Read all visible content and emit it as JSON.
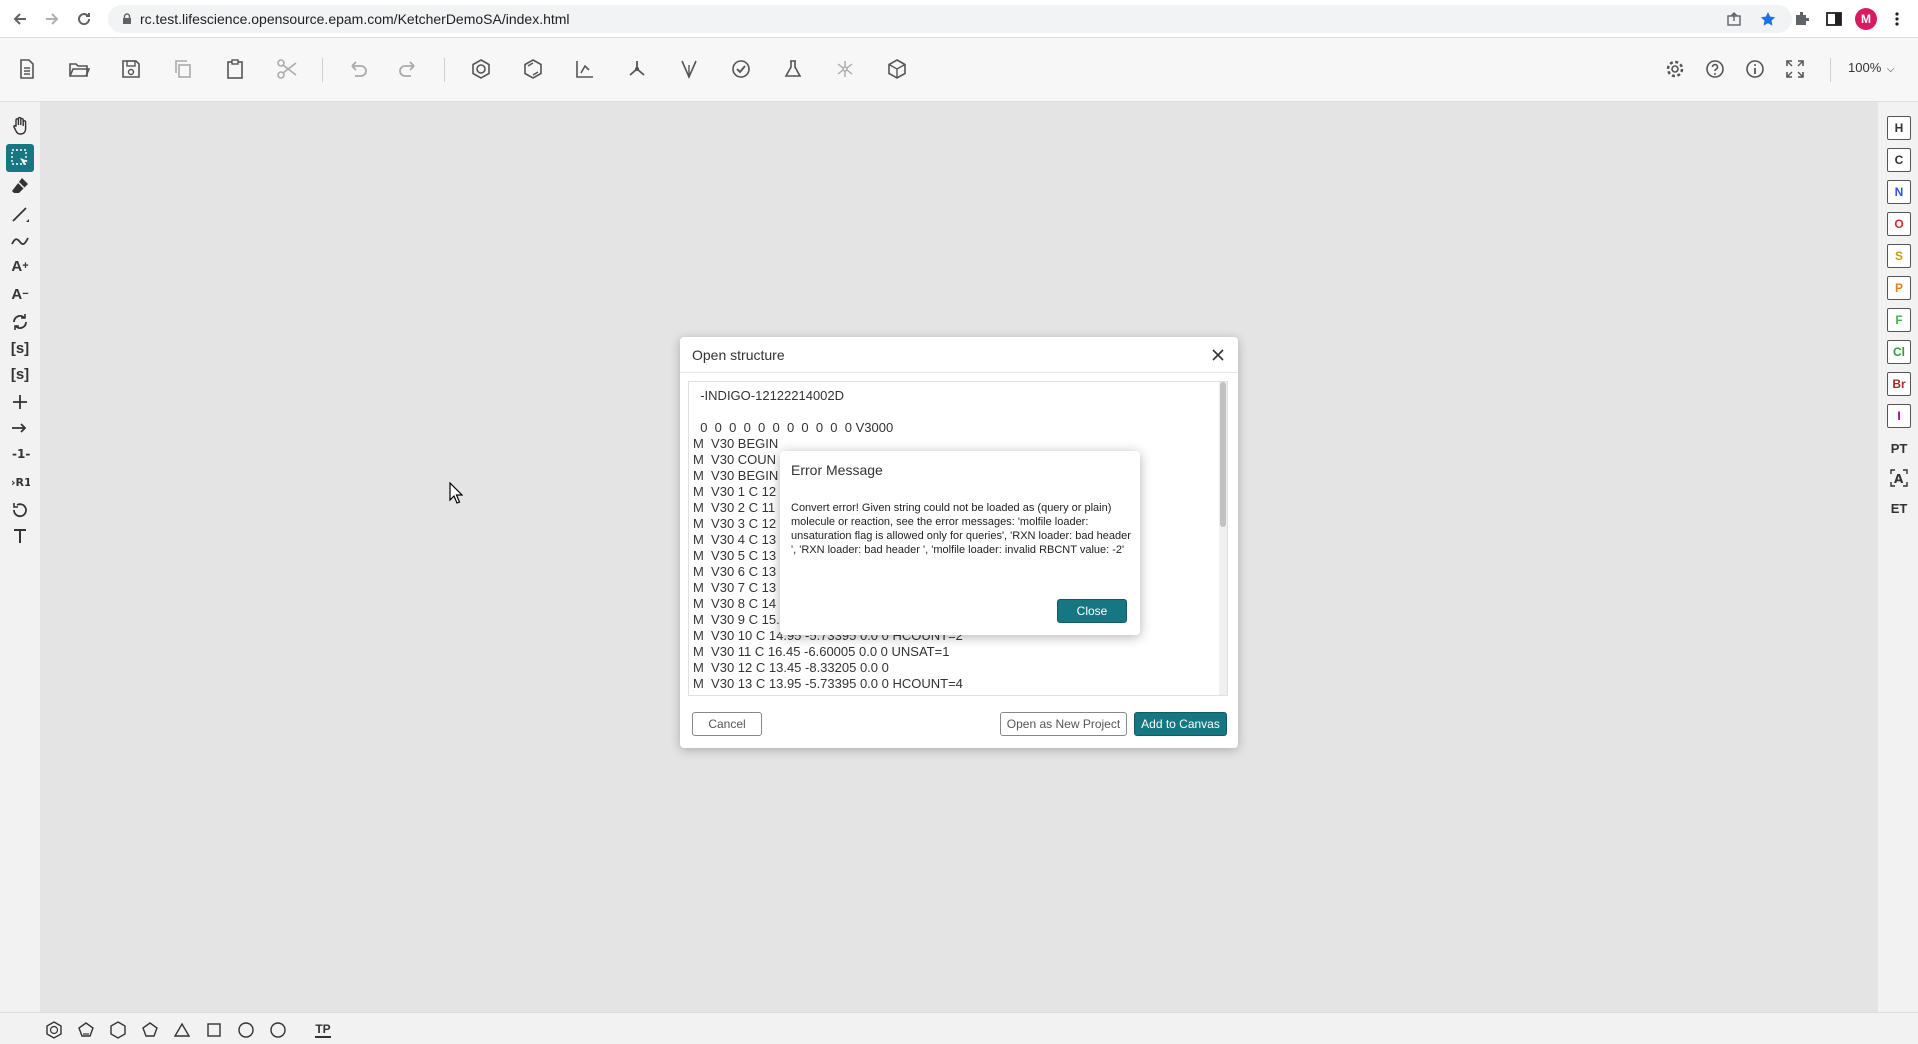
{
  "browser": {
    "url": "rc.test.lifescience.opensource.epam.com/KetcherDemoSA/index.html",
    "avatar_letter": "M"
  },
  "toolbar": {
    "zoom": "100%"
  },
  "elements": [
    "H",
    "C",
    "N",
    "O",
    "S",
    "P",
    "F",
    "Cl",
    "Br",
    "I"
  ],
  "element_colors": [
    "#333333",
    "#333333",
    "#3050f8",
    "#d32f2f",
    "#c8a000",
    "#e67e22",
    "#4caf50",
    "#2e9d2e",
    "#a52a2a",
    "#940094"
  ],
  "right_extra": [
    "PT",
    "ET"
  ],
  "open_dialog": {
    "title": "Open structure",
    "molfile": [
      "  -INDIGO-12122214002D",
      "",
      "  0  0  0  0  0  0  0  0  0  0  0 V3000",
      "M  V30 BEGIN",
      "M  V30 COUN",
      "M  V30 BEGIN",
      "M  V30 1 C 12",
      "M  V30 2 C 11",
      "M  V30 3 C 12",
      "M  V30 4 C 13",
      "M  V30 5 C 13",
      "M  V30 6 C 13",
      "M  V30 7 C 13",
      "M  V30 8 C 14",
      "M  V30 9 C 15.45 -6.60005 0.0 0",
      "M  V30 10 C 14.95 -5.73395 0.0 0 HCOUNT=2",
      "M  V30 11 C 16.45 -6.60005 0.0 0 UNSAT=1",
      "M  V30 12 C 13.45 -8.33205 0.0 0",
      "M  V30 13 C 13.95 -5.73395 0.0 0 HCOUNT=4"
    ],
    "cancel_label": "Cancel",
    "open_new_label": "Open as New Project",
    "add_label": "Add to Canvas"
  },
  "error_dialog": {
    "title": "Error Message",
    "message": "Convert error! Given string could not be loaded as (query or plain) molecule or reaction, see the error messages: 'molfile loader: unsaturation flag is allowed only for queries', 'RXN loader: bad header ', 'RXN loader: bad header ', 'molfile loader: invalid RBCNT value: -2'",
    "close_label": "Close"
  },
  "bottom": {
    "template_label": "TP"
  }
}
